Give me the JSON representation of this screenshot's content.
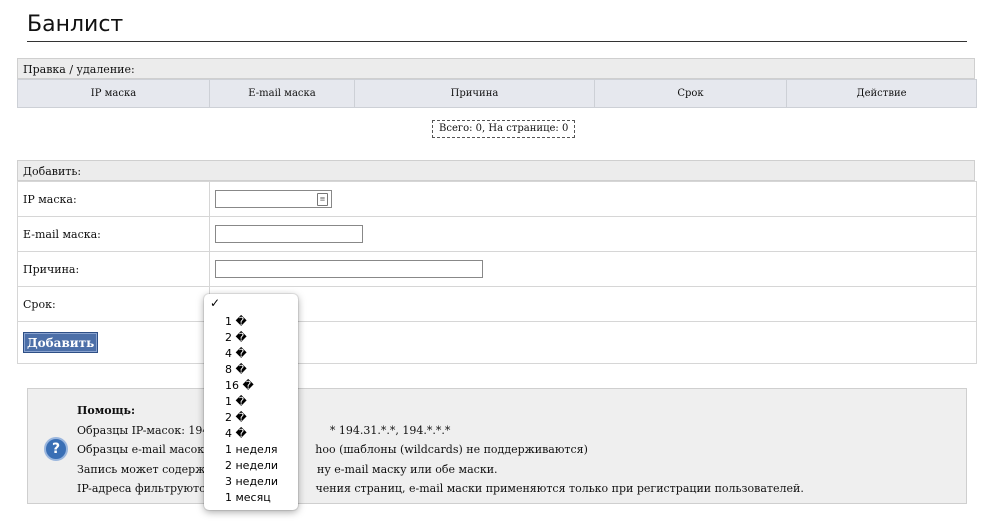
{
  "page": {
    "title": "Банлист"
  },
  "list_section": {
    "header": "Правка / удаление:",
    "columns": [
      "IP маска",
      "E-mail маска",
      "Причина",
      "Срок",
      "Действие"
    ],
    "pager": "Всего: 0, На странице: 0"
  },
  "add_section": {
    "header": "Добавить:",
    "fields": {
      "ip_label": "IP маска:",
      "ip_value": "",
      "email_label": "E-mail маска:",
      "email_value": "",
      "reason_label": "Причина:",
      "reason_value": "",
      "term_label": "Срок:",
      "term_selected": ""
    },
    "submit_label": "Добавить"
  },
  "term_dropdown": {
    "checked_index": 0,
    "options": [
      "",
      "1 �",
      "2 �",
      "4 �",
      "8 �",
      "16 �",
      "1 �",
      "2 �",
      "4 �",
      "1 неделя",
      "2 недели",
      "3 недели",
      "1 месяц"
    ]
  },
  "help": {
    "title": "Помощь:",
    "lines": [
      "Образцы IP-масок: 194.3",
      "Образцы e-mail масок: @",
      "Запись может содержать",
      "IP-адреса фильтруются д"
    ],
    "lines_right": [
      "* 194.31.*.*, 194.*.*.*",
      "hoo (шаблоны (wildcards) не поддерживаются)",
      "ну e-mail маску или обе маски.",
      "чения страниц, e-mail маски применяются только при регистрации пользователей."
    ],
    "icon": "question-icon"
  }
}
